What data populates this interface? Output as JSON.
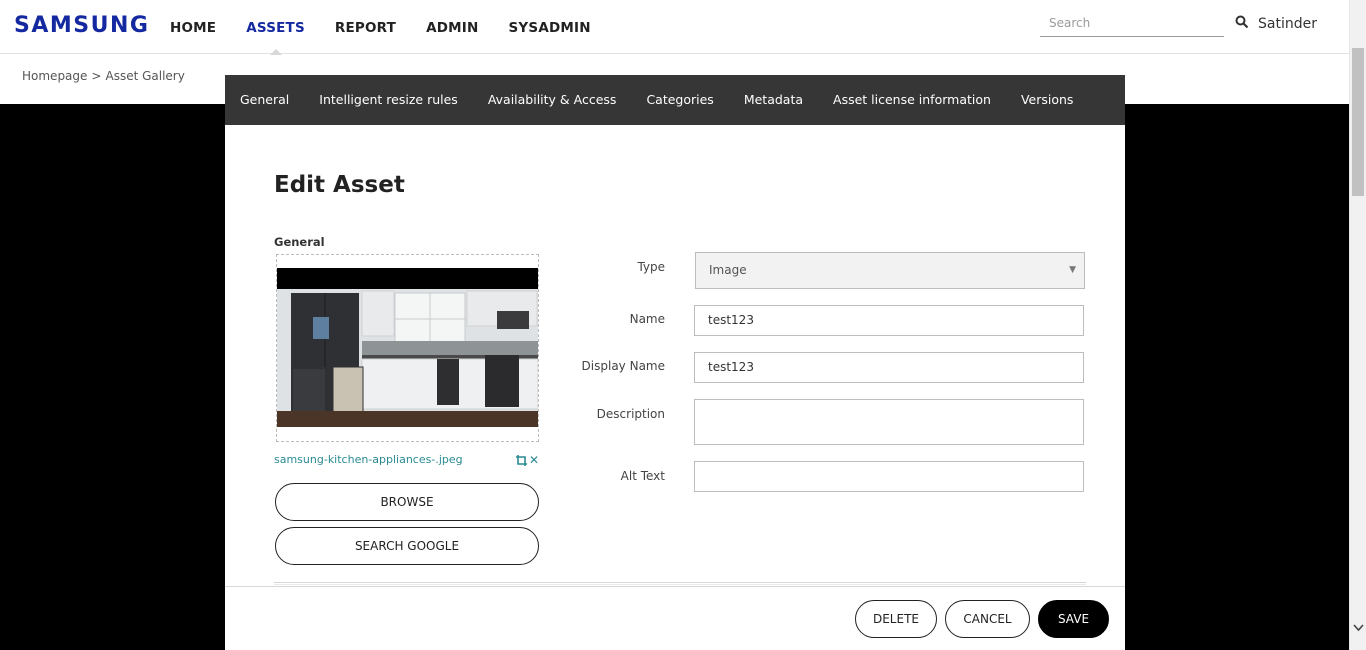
{
  "brand": {
    "logo_text": "SAMSUNG",
    "color": "#1428a0"
  },
  "nav": {
    "items": [
      {
        "label": "HOME"
      },
      {
        "label": "ASSETS",
        "active": true
      },
      {
        "label": "REPORT"
      },
      {
        "label": "ADMIN"
      },
      {
        "label": "SYSADMIN"
      }
    ]
  },
  "header": {
    "search_placeholder": "Search",
    "user_name": "Satinder"
  },
  "breadcrumb": {
    "items": [
      "Homepage",
      "Asset Gallery"
    ],
    "separator": ">"
  },
  "modal": {
    "tabs": [
      {
        "label": "General"
      },
      {
        "label": "Intelligent resize rules"
      },
      {
        "label": "Availability & Access"
      },
      {
        "label": "Categories"
      },
      {
        "label": "Metadata"
      },
      {
        "label": "Asset license information"
      },
      {
        "label": "Versions"
      }
    ],
    "title": "Edit Asset",
    "section_label": "General",
    "file_name": "samsung-kitchen-appliances-.jpeg",
    "browse_label": "BROWSE",
    "search_google_label": "SEARCH GOOGLE",
    "form": {
      "type_label": "Type",
      "type_value": "Image",
      "name_label": "Name",
      "name_value": "test123",
      "display_name_label": "Display Name",
      "display_name_value": "test123",
      "description_label": "Description",
      "description_value": "",
      "alt_text_label": "Alt Text",
      "alt_text_value": ""
    },
    "footer": {
      "delete_label": "DELETE",
      "cancel_label": "CANCEL",
      "save_label": "SAVE"
    }
  },
  "colors": {
    "tab_bar": "#363636",
    "link_teal": "#2a8a92",
    "backdrop": "#000000"
  },
  "icons": [
    "search-icon",
    "crop-icon",
    "close-icon",
    "chevron-down-icon",
    "chevron-right-icon"
  ]
}
